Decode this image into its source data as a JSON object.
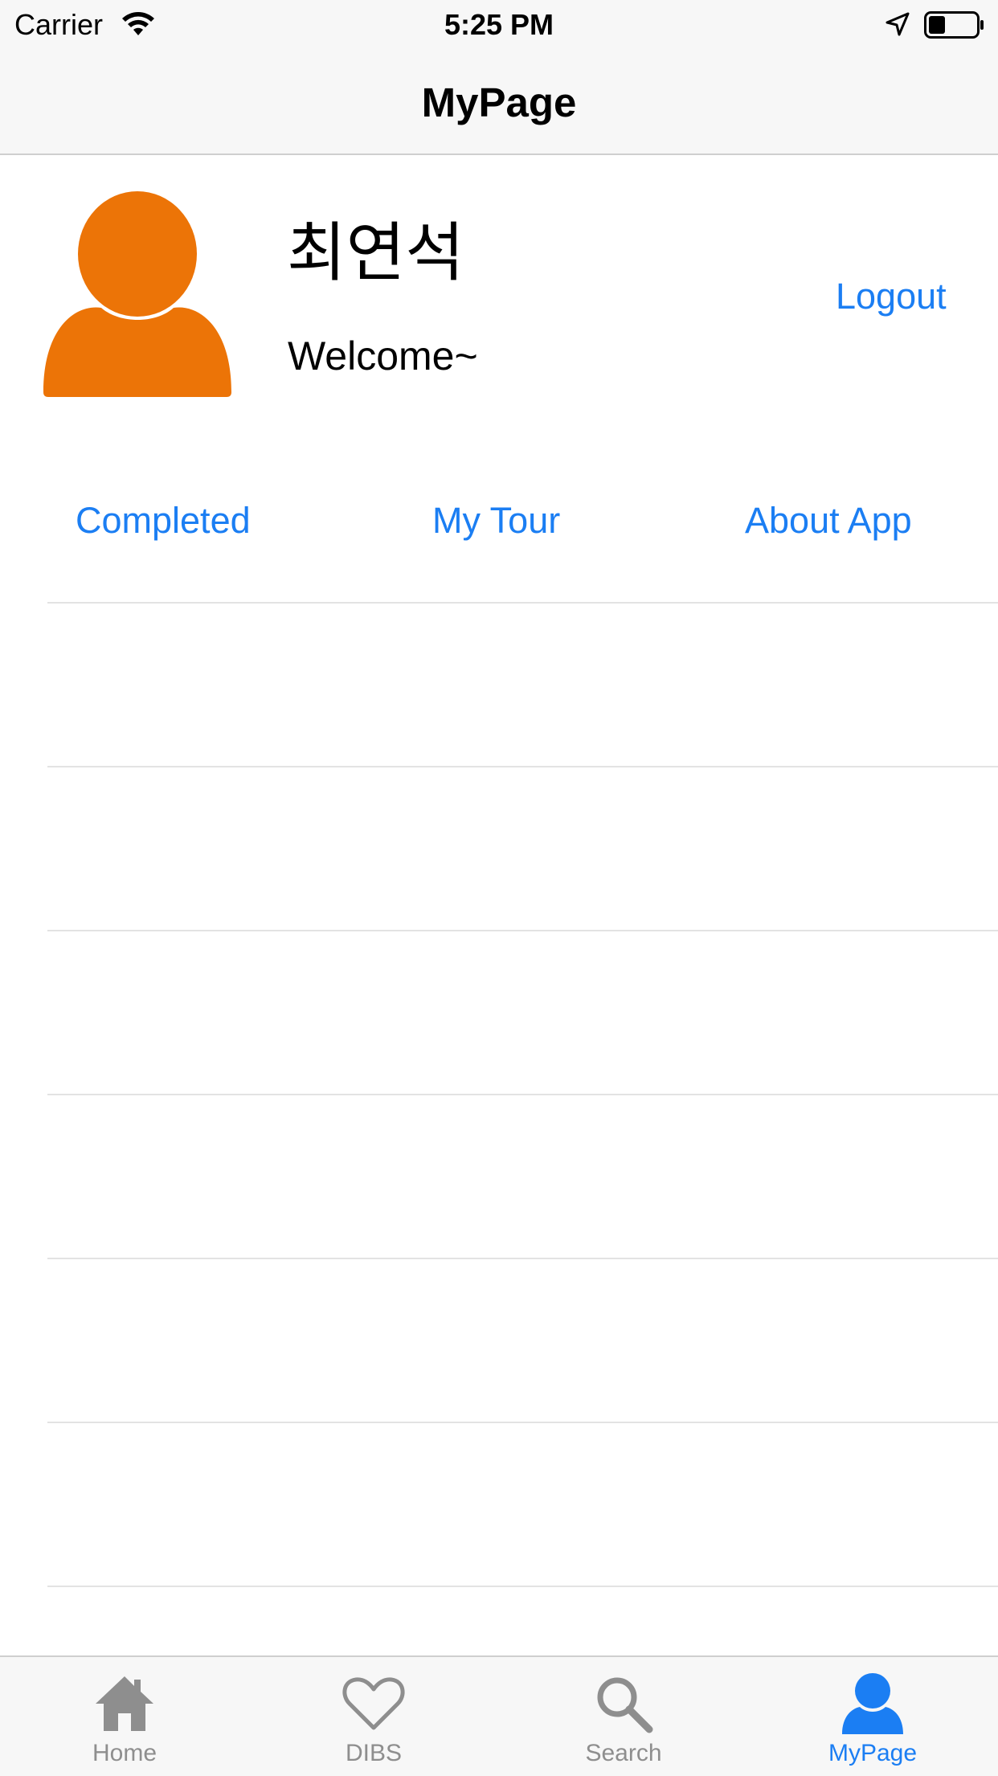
{
  "status_bar": {
    "carrier": "Carrier",
    "time": "5:25 PM"
  },
  "nav": {
    "title": "MyPage"
  },
  "profile": {
    "name": "최연석",
    "greeting": "Welcome~",
    "logout_label": "Logout",
    "avatar_color": "#ec7407"
  },
  "segments": {
    "completed": "Completed",
    "my_tour": "My Tour",
    "about_app": "About App"
  },
  "tab_bar": {
    "items": [
      {
        "label": "Home",
        "icon": "home-icon"
      },
      {
        "label": "DIBS",
        "icon": "heart-icon"
      },
      {
        "label": "Search",
        "icon": "search-icon"
      },
      {
        "label": "MyPage",
        "icon": "person-icon"
      }
    ],
    "active_index": 3
  },
  "colors": {
    "accent": "#1b7ef3",
    "inactive": "#8e8e8e",
    "avatar": "#ec7407"
  }
}
